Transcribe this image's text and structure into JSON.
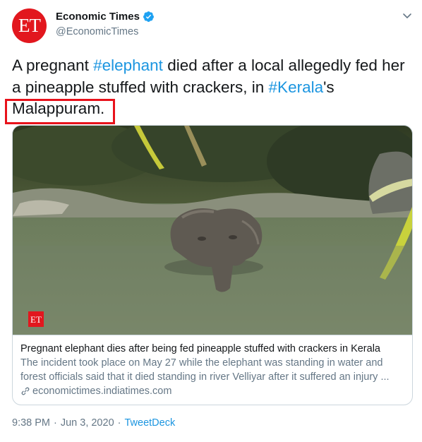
{
  "author": {
    "avatar_text": "ET",
    "display_name": "Economic Times",
    "handle": "@EconomicTimes",
    "verified_icon": "verified-badge-icon"
  },
  "tweet": {
    "text_part1": "A pregnant ",
    "hashtag1": "#elephant",
    "text_part2": " died after a local allegedly fed her a pineapple stuffed with crackers, in ",
    "hashtag2": "#Kerala",
    "text_part3": "'s Malappuram."
  },
  "card": {
    "image_watermark": "ET",
    "title": "Pregnant elephant dies after being fed pineapple stuffed with crackers in Kerala",
    "description": "The incident took place on May 27 while the elephant was standing in water and forest officials said that it died standing in river Velliyar after it suffered an injury ...",
    "domain": "economictimes.indiatimes.com"
  },
  "meta": {
    "time": "9:38 PM",
    "separator": "·",
    "date": "Jun 3, 2020",
    "source": "TweetDeck"
  },
  "colors": {
    "brand_red": "#e2171e",
    "link_blue": "#1b95e0",
    "highlight_red": "#e8121b"
  }
}
